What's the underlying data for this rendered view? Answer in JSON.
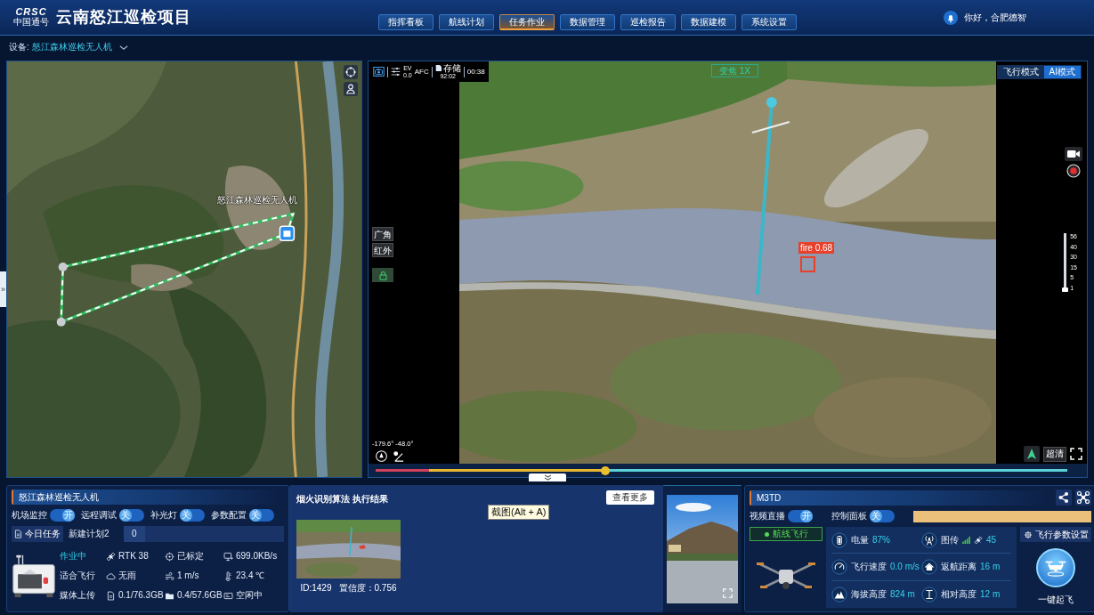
{
  "header": {
    "logo_top": "CRSC",
    "logo_bottom": "中国通号",
    "title": "云南怒江巡检项目",
    "nav": [
      {
        "label": "指挥看板",
        "selected": false
      },
      {
        "label": "航线计划",
        "selected": false
      },
      {
        "label": "任务作业",
        "selected": true
      },
      {
        "label": "数据管理",
        "selected": false
      },
      {
        "label": "巡检报告",
        "selected": false
      },
      {
        "label": "数据建模",
        "selected": false
      },
      {
        "label": "系统设置",
        "selected": false
      }
    ],
    "greeting": "你好，合肥德智"
  },
  "device_bar": {
    "label": "设备:",
    "device": "怒江森林巡检无人机"
  },
  "map": {
    "expand_tab": "»",
    "marker_label": "怒江森林巡检无人机"
  },
  "video": {
    "top_bar": {
      "ev_label": "EV",
      "ev_value": "0.0",
      "focus_mode": "AFC",
      "storage_label": "存储",
      "storage_value": "92:02",
      "elapsed": "00:38"
    },
    "zoom_label": "变焦 1X",
    "modes": [
      {
        "label": "飞行模式",
        "selected": false
      },
      {
        "label": "AI模式",
        "selected": true
      }
    ],
    "lens_buttons": [
      "广角",
      "红外"
    ],
    "detection_label": "fire 0.68",
    "zoom_scale": {
      "ticks": [
        "56",
        "40",
        "30",
        "15",
        "5",
        "1"
      ],
      "level": 0
    },
    "gimbal_angles": "-179.6° -48.0°",
    "quality_button": "超清",
    "timeline": {
      "level": 0.33
    }
  },
  "airport_panel": {
    "title": "怒江森林巡检无人机",
    "toggles": [
      {
        "label": "机场监控",
        "state": "开",
        "on": true
      },
      {
        "label": "远程调试",
        "state": "关",
        "on": false
      },
      {
        "label": "补光灯",
        "state": "关",
        "on": false
      },
      {
        "label": "参数配置",
        "state": "关",
        "on": false
      }
    ],
    "today_button": "今日任务",
    "plan_name": "新建计划2",
    "plan_count": "0",
    "status_rows": [
      {
        "label": "作业中",
        "active": true,
        "items": [
          {
            "kind": "rtk",
            "text": "RTK 38"
          },
          {
            "kind": "calibration",
            "text": "已标定"
          },
          {
            "kind": "network",
            "text": "699.0KB/s"
          }
        ]
      },
      {
        "label": "适合飞行",
        "active": false,
        "items": [
          {
            "kind": "weather",
            "text": "无雨"
          },
          {
            "kind": "wind",
            "text": "1 m/s"
          },
          {
            "kind": "temperature",
            "text": "23.4 ℃"
          }
        ]
      },
      {
        "label": "媒体上传",
        "active": false,
        "items": [
          {
            "kind": "storage",
            "text": "0.1/76.3GB"
          },
          {
            "kind": "disk",
            "text": "0.4/57.6GB"
          },
          {
            "kind": "task",
            "text": "空闲中"
          }
        ]
      }
    ]
  },
  "detection_result": {
    "title": "烟火识别算法 执行结果",
    "more_button": "查看更多",
    "tooltip": "截图(Alt + A)",
    "record_id": "ID:1429",
    "confidence": "置信度：0.756"
  },
  "drone_panel": {
    "title": "M3TD",
    "toggles": [
      {
        "label": "视频直播",
        "state": "开",
        "on": true
      },
      {
        "label": "控制面板",
        "state": "关",
        "on": false
      }
    ],
    "flight_status": "航线飞行",
    "stats": [
      {
        "kind": "battery",
        "label": "电量",
        "value": "87%"
      },
      {
        "kind": "signal",
        "label": "图传",
        "value": "45"
      },
      {
        "kind": "speed",
        "label": "飞行速度",
        "value": "0.0 m/s"
      },
      {
        "kind": "distance",
        "label": "返航距离",
        "value": "16 m"
      },
      {
        "kind": "altitude",
        "label": "海拔高度",
        "value": "824 m"
      },
      {
        "kind": "height",
        "label": "相对高度",
        "value": "12 m"
      }
    ],
    "settings_button": "飞行参数设置",
    "takeoff_label": "一键起飞"
  }
}
